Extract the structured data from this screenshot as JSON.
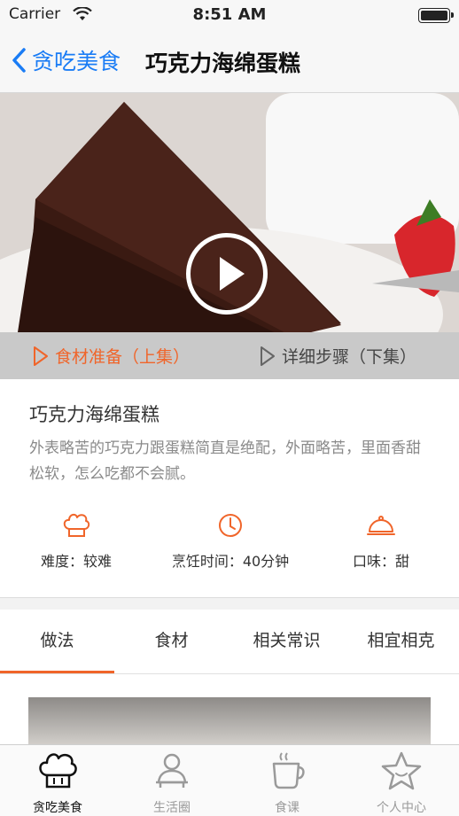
{
  "status_bar": {
    "carrier": "Carrier",
    "time": "8:51 AM"
  },
  "nav": {
    "back_label": "贪吃美食",
    "title": "巧克力海绵蛋糕"
  },
  "episodes": [
    {
      "label": "食材准备（上集）",
      "active": true
    },
    {
      "label": "详细步骤（下集）",
      "active": false
    }
  ],
  "recipe": {
    "name": "巧克力海绵蛋糕",
    "description": "外表略苦的巧克力跟蛋糕简直是绝配，外面略苦，里面香甜松软，怎么吃都不会腻。",
    "meta": [
      {
        "icon": "chef-hat-icon",
        "label": "难度：较难"
      },
      {
        "icon": "clock-icon",
        "label": "烹饪时间：40分钟"
      },
      {
        "icon": "cloche-icon",
        "label": "口味：甜"
      }
    ]
  },
  "tabs": [
    {
      "label": "做法",
      "active": true
    },
    {
      "label": "食材",
      "active": false
    },
    {
      "label": "相关常识",
      "active": false
    },
    {
      "label": "相宜相克",
      "active": false
    }
  ],
  "tab_bar": [
    {
      "icon": "chef-hat-icon",
      "label": "贪吃美食",
      "active": true
    },
    {
      "icon": "person-icon",
      "label": "生活圈",
      "active": false
    },
    {
      "icon": "coffee-cup-icon",
      "label": "食课",
      "active": false
    },
    {
      "icon": "star-icon",
      "label": "个人中心",
      "active": false
    }
  ],
  "colors": {
    "accent": "#f0652a",
    "link": "#1a7cf5"
  }
}
